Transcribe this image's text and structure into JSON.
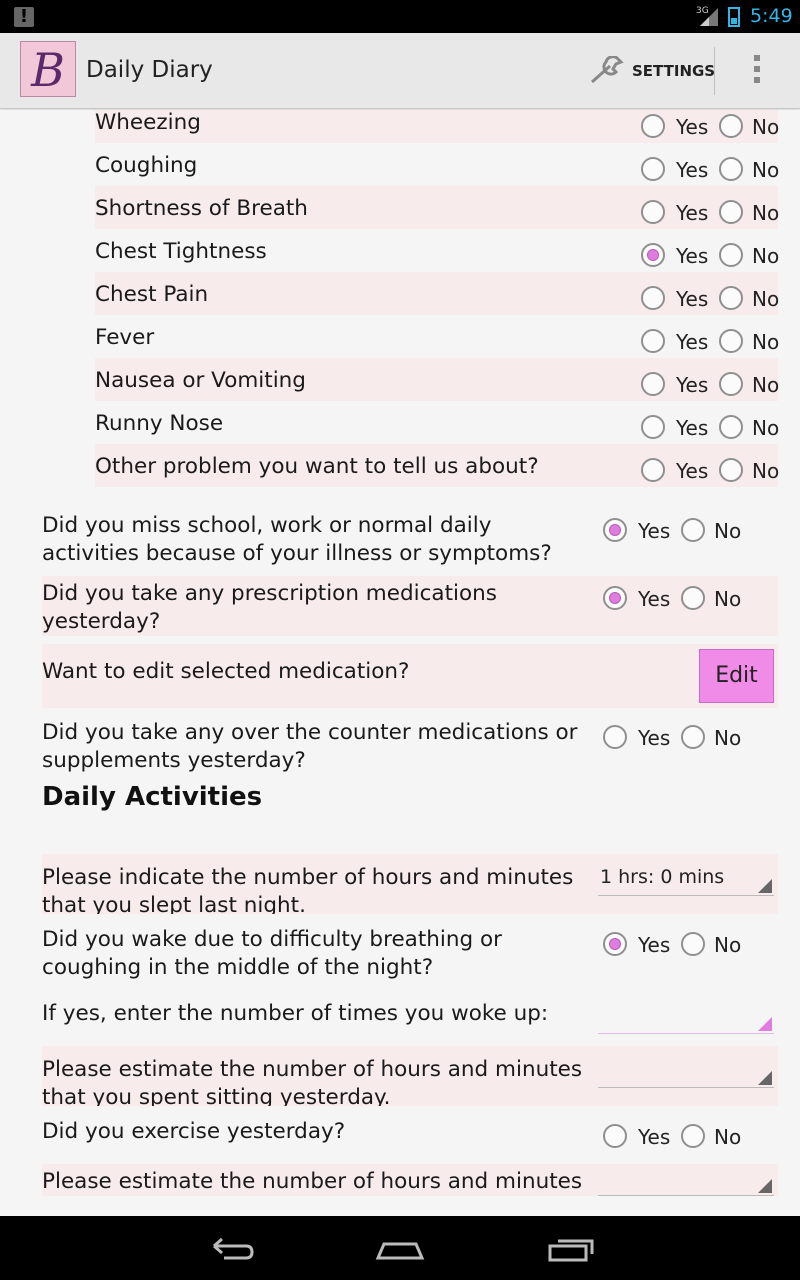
{
  "status_bar": {
    "network": "3G",
    "time": "5:49"
  },
  "app": {
    "title": "Daily Diary",
    "settings_label": "SETTINGS"
  },
  "symptoms": [
    {
      "label": "Wheezing",
      "answer": ""
    },
    {
      "label": "Coughing",
      "answer": ""
    },
    {
      "label": "Shortness of Breath",
      "answer": ""
    },
    {
      "label": "Chest Tightness",
      "answer": "Yes"
    },
    {
      "label": "Chest Pain",
      "answer": ""
    },
    {
      "label": "Fever",
      "answer": ""
    },
    {
      "label": "Nausea or Vomiting",
      "answer": ""
    },
    {
      "label": "Runny Nose",
      "answer": ""
    },
    {
      "label": "Other problem you want to tell us about?",
      "answer": ""
    }
  ],
  "options": {
    "yes": "Yes",
    "no": "No"
  },
  "questions": {
    "miss_school": {
      "line1": "Did you miss school, work or normal daily",
      "line2": "activities because of your illness or symptoms?",
      "answer": "Yes"
    },
    "prescription": {
      "line1": "Did you take any prescription medications",
      "line2": "yesterday?",
      "answer": "Yes"
    },
    "edit_med": {
      "text": "Want to edit selected medication?",
      "button": "Edit"
    },
    "otc": {
      "line1": "Did you take any over the counter medications or",
      "line2": "supplements yesterday?",
      "answer": ""
    }
  },
  "daily_activities": {
    "heading": "Daily Activities",
    "sleep": {
      "line1": "Please indicate the number of hours and minutes",
      "line2": "that you slept last night.",
      "value": "1 hrs: 0 mins"
    },
    "wake": {
      "line1": "Did you wake due to difficulty breathing or",
      "line2": "coughing in the middle of the night?",
      "answer": "Yes"
    },
    "wake_times": {
      "text": "If yes, enter the number of times you woke up:",
      "value": ""
    },
    "sitting": {
      "line1": "Please estimate the number of hours and minutes",
      "line2": "that you spent sitting yesterday.",
      "value": ""
    },
    "exercise": {
      "text": "Did you exercise yesterday?",
      "answer": ""
    },
    "exercise_time": {
      "line1": "Please estimate the number of hours and minutes",
      "value": ""
    }
  }
}
